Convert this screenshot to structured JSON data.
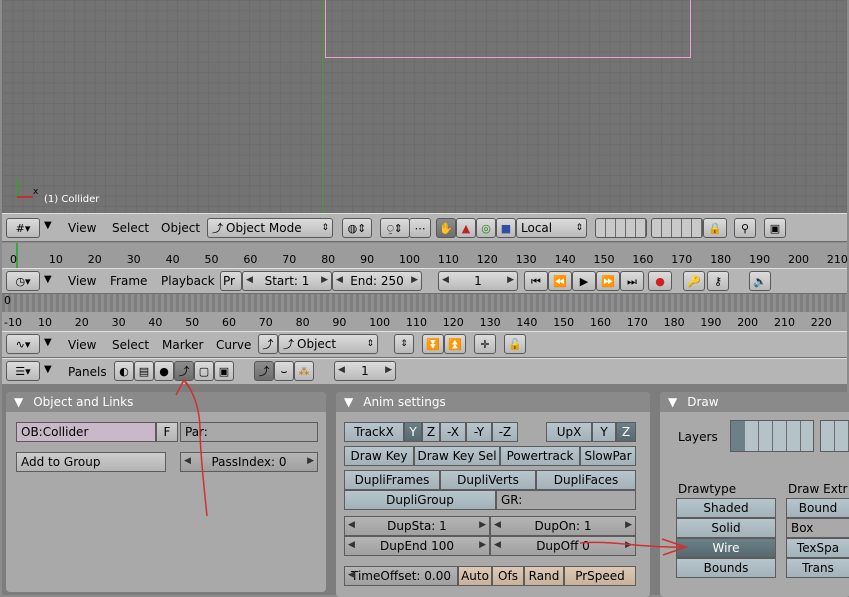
{
  "viewport": {
    "object_label": "(1) Collider",
    "axis_x_label": "x"
  },
  "view3d_header": {
    "menus": [
      "View",
      "Select",
      "Object"
    ],
    "mode": "Object Mode",
    "orientation": "Local"
  },
  "timeline_ruler": {
    "ticks": [
      "0",
      "10",
      "20",
      "30",
      "40",
      "50",
      "60",
      "70",
      "80",
      "90",
      "100",
      "110",
      "120",
      "130",
      "140",
      "150",
      "160",
      "170",
      "180",
      "190",
      "200",
      "210"
    ]
  },
  "timeline_header": {
    "menus": [
      "View",
      "Frame",
      "Playback"
    ],
    "pr_label": "Pr",
    "start": "Start: 1",
    "end": "End: 250",
    "current_frame": "1"
  },
  "ipo_ruler": {
    "top_tick": "0",
    "ticks": [
      "-10",
      "10",
      "20",
      "30",
      "40",
      "50",
      "60",
      "70",
      "80",
      "90",
      "100",
      "110",
      "120",
      "130",
      "140",
      "150",
      "160",
      "170",
      "180",
      "190",
      "200",
      "210",
      "220"
    ]
  },
  "ipo_header": {
    "menus": [
      "View",
      "Select",
      "Marker",
      "Curve"
    ],
    "type": "Object"
  },
  "buttons_header": {
    "panels_label": "Panels",
    "frame": "1"
  },
  "object_links": {
    "title": "Object and Links",
    "ob_field": "OB:Collider",
    "f_button": "F",
    "par_field": "Par:",
    "add_group": "Add to Group",
    "pass_index": "PassIndex: 0"
  },
  "anim_settings": {
    "title": "Anim settings",
    "track": [
      "TrackX",
      "Y",
      "Z",
      "-X",
      "-Y",
      "-Z"
    ],
    "up": [
      "UpX",
      "Y",
      "Z"
    ],
    "row2": [
      "Draw Key",
      "Draw Key Sel",
      "Powertrack",
      "SlowPar"
    ],
    "row3": [
      "DupliFrames",
      "DupliVerts",
      "DupliFaces"
    ],
    "dupligroup": "DupliGroup",
    "gr_field": "GR:",
    "dupsta": "DupSta: 1",
    "dupon": "DupOn: 1",
    "dupend": "DupEnd 100",
    "dupoff": "DupOff 0",
    "timeoffset": "TimeOffset: 0.00",
    "row_last": [
      "Auto",
      "Ofs",
      "Rand",
      "PrSpeed"
    ]
  },
  "draw_panel": {
    "title": "Draw",
    "layers_label": "Layers",
    "drawtype_label": "Drawtype",
    "draw_extra_label": "Draw Extr",
    "drawtypes": [
      "Shaded",
      "Solid",
      "Wire",
      "Bounds"
    ],
    "extra": [
      "Bound",
      "Box",
      "TexSpa",
      "Trans"
    ]
  },
  "colors": {
    "panel_bg": "#a9a9a9",
    "selected_blue": "#57696f",
    "annotation_red": "#d03030"
  }
}
